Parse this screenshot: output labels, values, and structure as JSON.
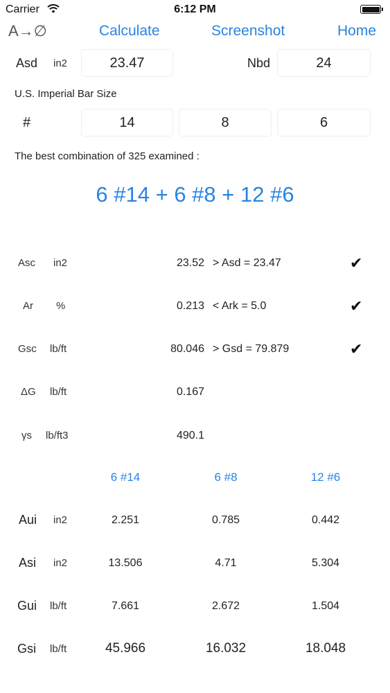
{
  "status": {
    "carrier": "Carrier",
    "time": "6:12 PM"
  },
  "nav": {
    "clear": "A→∅",
    "calculate": "Calculate",
    "screenshot": "Screenshot",
    "home": "Home"
  },
  "inputs": {
    "asd_label": "Asd",
    "asd_unit": "in2",
    "asd_value": "23.47",
    "nbd_label": "Nbd",
    "nbd_value": "24",
    "bar_size_label": "U.S. Imperial Bar Size",
    "hash_label": "#",
    "bar1": "14",
    "bar2": "8",
    "bar3": "6"
  },
  "summary": {
    "text": "The best combination of  325 examined :"
  },
  "result": "6 #14 + 6 #8 + 12 #6",
  "checks": [
    {
      "name": "Asc",
      "unit": "in2",
      "value": "23.52",
      "cmp": "> Asd = 23.47",
      "ok": "✔"
    },
    {
      "name": "Ar",
      "unit": "%",
      "value": "0.213",
      "cmp": "< Ark = 5.0",
      "ok": "✔"
    },
    {
      "name": "Gsc",
      "unit": "lb/ft",
      "value": "80.046",
      "cmp": "> Gsd = 79.879",
      "ok": "✔"
    },
    {
      "name": "ΔG",
      "unit": "lb/ft",
      "value": "0.167",
      "cmp": "",
      "ok": ""
    },
    {
      "name": "γs",
      "unit": "lb/ft3",
      "value": "490.1",
      "cmp": "",
      "ok": ""
    }
  ],
  "bars": {
    "headers": [
      "6 #14",
      "6 #8",
      "12 #6"
    ],
    "rows": [
      {
        "name": "Aui",
        "unit": "in2",
        "values": [
          "2.251",
          "0.785",
          "0.442"
        ]
      },
      {
        "name": "Asi",
        "unit": "in2",
        "values": [
          "13.506",
          "4.71",
          "5.304"
        ]
      },
      {
        "name": "Gui",
        "unit": "lb/ft",
        "values": [
          "7.661",
          "2.672",
          "1.504"
        ]
      },
      {
        "name": "Gsi",
        "unit": "lb/ft",
        "values": [
          "45.966",
          "16.032",
          "18.048"
        ]
      }
    ]
  },
  "colors": {
    "accent": "#2a84e0",
    "text": "#222222"
  },
  "icons": {
    "wifi": "wifi-icon",
    "battery": "battery-icon",
    "check": "checkmark-icon"
  }
}
